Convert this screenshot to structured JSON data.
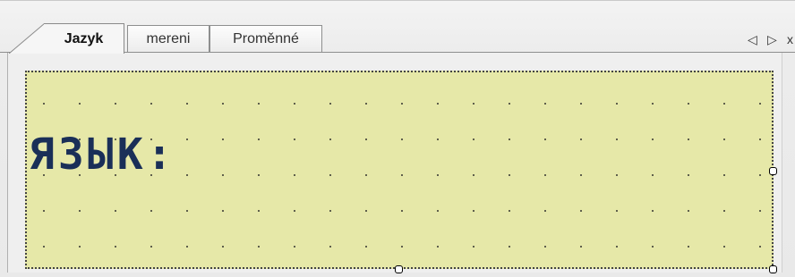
{
  "tabs": [
    {
      "label": "Jazyk",
      "active": true
    },
    {
      "label": "mereni",
      "active": false
    },
    {
      "label": "Proměnné",
      "active": false
    }
  ],
  "nav": {
    "prev": "◁",
    "next": "▷",
    "close": "x"
  },
  "lcd": {
    "text": "ЯЗЫК:",
    "background_color": "#e6e8a8",
    "text_color": "#1a2f58"
  }
}
